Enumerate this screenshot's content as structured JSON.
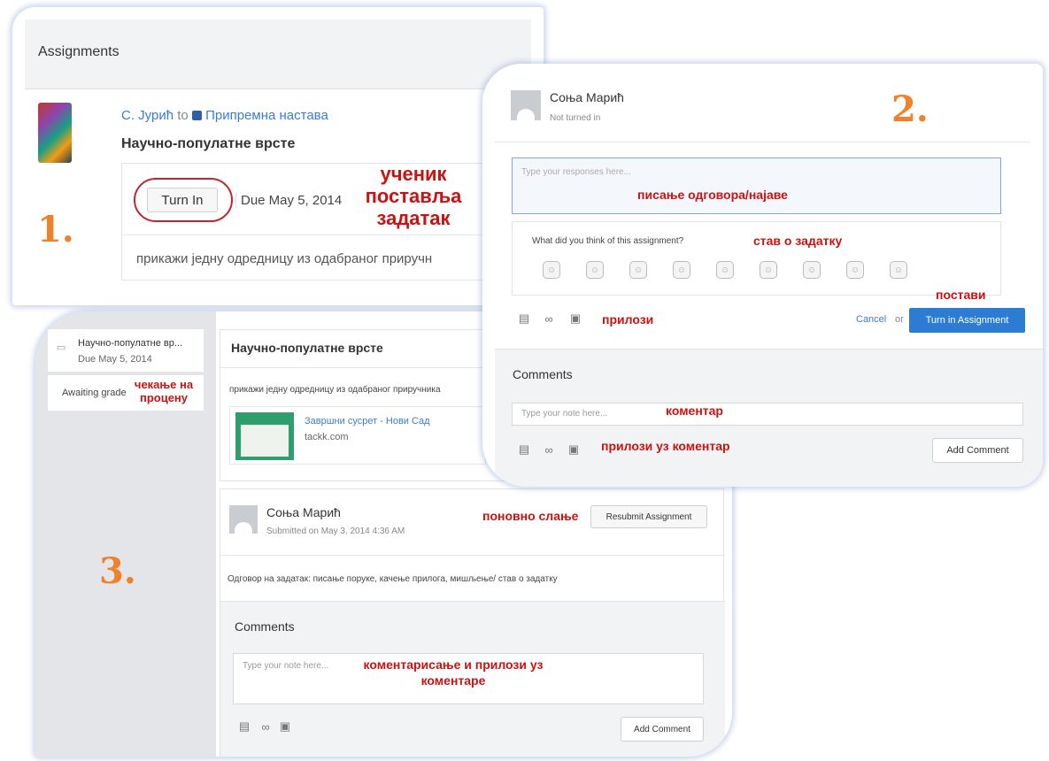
{
  "panel1": {
    "header": "Assignments",
    "author": "С. Јурић",
    "to_word": "to",
    "group": "Припремна настава",
    "title": "Научно-популатне врсте",
    "turn_in": "Turn In",
    "due": "Due May 5, 2014",
    "description": "прикажи једну одредницу из одабраног приручн"
  },
  "panel2": {
    "name": "Соња Марић",
    "status": "Not turned in",
    "response_placeholder": "Type your responses here...",
    "feedback_question": "What did you think of this assignment?",
    "cancel": "Cancel",
    "or_word": "or",
    "turn_in_assignment": "Turn in Assignment",
    "comments_heading": "Comments",
    "note_placeholder": "Type your note here...",
    "add_comment": "Add Comment"
  },
  "panel3": {
    "sidebar_title": "Научно-популатне вр...",
    "sidebar_due": "Due May 5, 2014",
    "awaiting": "Awaiting grade",
    "title": "Научно-популатне врсте",
    "description": "прикажи једну одредницу из одабраног приручника",
    "link_title": "Завршни сусрет - Нови Сад",
    "link_domain": "tackk.com",
    "name": "Соња Марић",
    "submitted": "Submitted on May 3, 2014 4:36 AM",
    "resubmit": "Resubmit Assignment",
    "answer": "Одговор на задатак: писање поруке, качење прилога, мишљење/ став о задатку",
    "comments_heading": "Comments",
    "note_placeholder": "Type your note here...",
    "add_comment": "Add Comment"
  },
  "annotations": {
    "n1": "1.",
    "n2": "2.",
    "n3": "3.",
    "student_line1": "ученик",
    "student_line2": "поставља",
    "student_line3": "задатак",
    "writing": "писање одговора/најаве",
    "attitude": "став о задатку",
    "submit": "постави",
    "attachments": "прилози",
    "comment": "коментар",
    "comment_attachments": "прилози уз коментар",
    "waiting_line1": "чекање на",
    "waiting_line2": "процену",
    "resend": "поновно слање",
    "commenting_line1": "коментарисање и прилози уз",
    "commenting_line2": "коментаре"
  },
  "colors": {
    "annotation_red": "#cc1111",
    "number_orange": "#f0802a",
    "primary_blue": "#2d7cd3",
    "link_blue": "#3a7bd5"
  }
}
